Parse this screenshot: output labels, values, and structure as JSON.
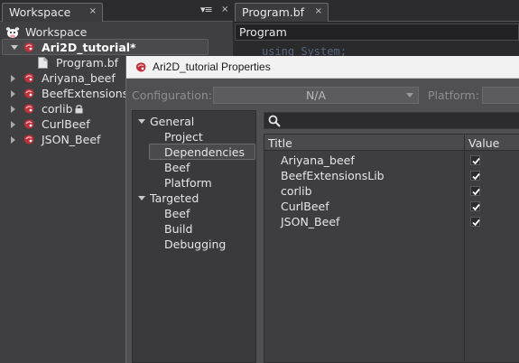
{
  "workspace": {
    "tab_label": "Workspace",
    "close_glyph": "×",
    "menu_glyph": "▾≡",
    "root_label": "Workspace",
    "tree": [
      {
        "label": "Ari2D_tutorial*",
        "expanded": true,
        "selected": true
      },
      {
        "label": "Program.bf",
        "file": true
      },
      {
        "label": "Ariyana_beef"
      },
      {
        "label": "BeefExtensionsL"
      },
      {
        "label": "corlib",
        "locked": true
      },
      {
        "label": "CurlBeef"
      },
      {
        "label": "JSON_Beef"
      }
    ]
  },
  "editor": {
    "tab_label": "Program.bf",
    "close_glyph": "×",
    "combo_value": "Program",
    "code_peek": "using System;"
  },
  "dialog": {
    "title": "Ari2D_tutorial Properties",
    "configuration_label": "Configuration:",
    "configuration_value": "N/A",
    "platform_label": "Platform:",
    "categories": {
      "general": "General",
      "project": "Project",
      "dependencies": "Dependencies",
      "beef": "Beef",
      "platform": "Platform",
      "targeted": "Targeted",
      "targeted_beef": "Beef",
      "build": "Build",
      "debugging": "Debugging"
    },
    "columns": {
      "title": "Title",
      "value": "Value"
    },
    "dependencies": [
      {
        "title": "Ariyana_beef",
        "checked": true
      },
      {
        "title": "BeefExtensionsLib",
        "checked": true
      },
      {
        "title": "corlib",
        "checked": true
      },
      {
        "title": "CurlBeef",
        "checked": true
      },
      {
        "title": "JSON_Beef",
        "checked": true
      }
    ]
  },
  "colors": {
    "project_icon": "#c0303a",
    "accent_bg": "#3f3f41"
  }
}
